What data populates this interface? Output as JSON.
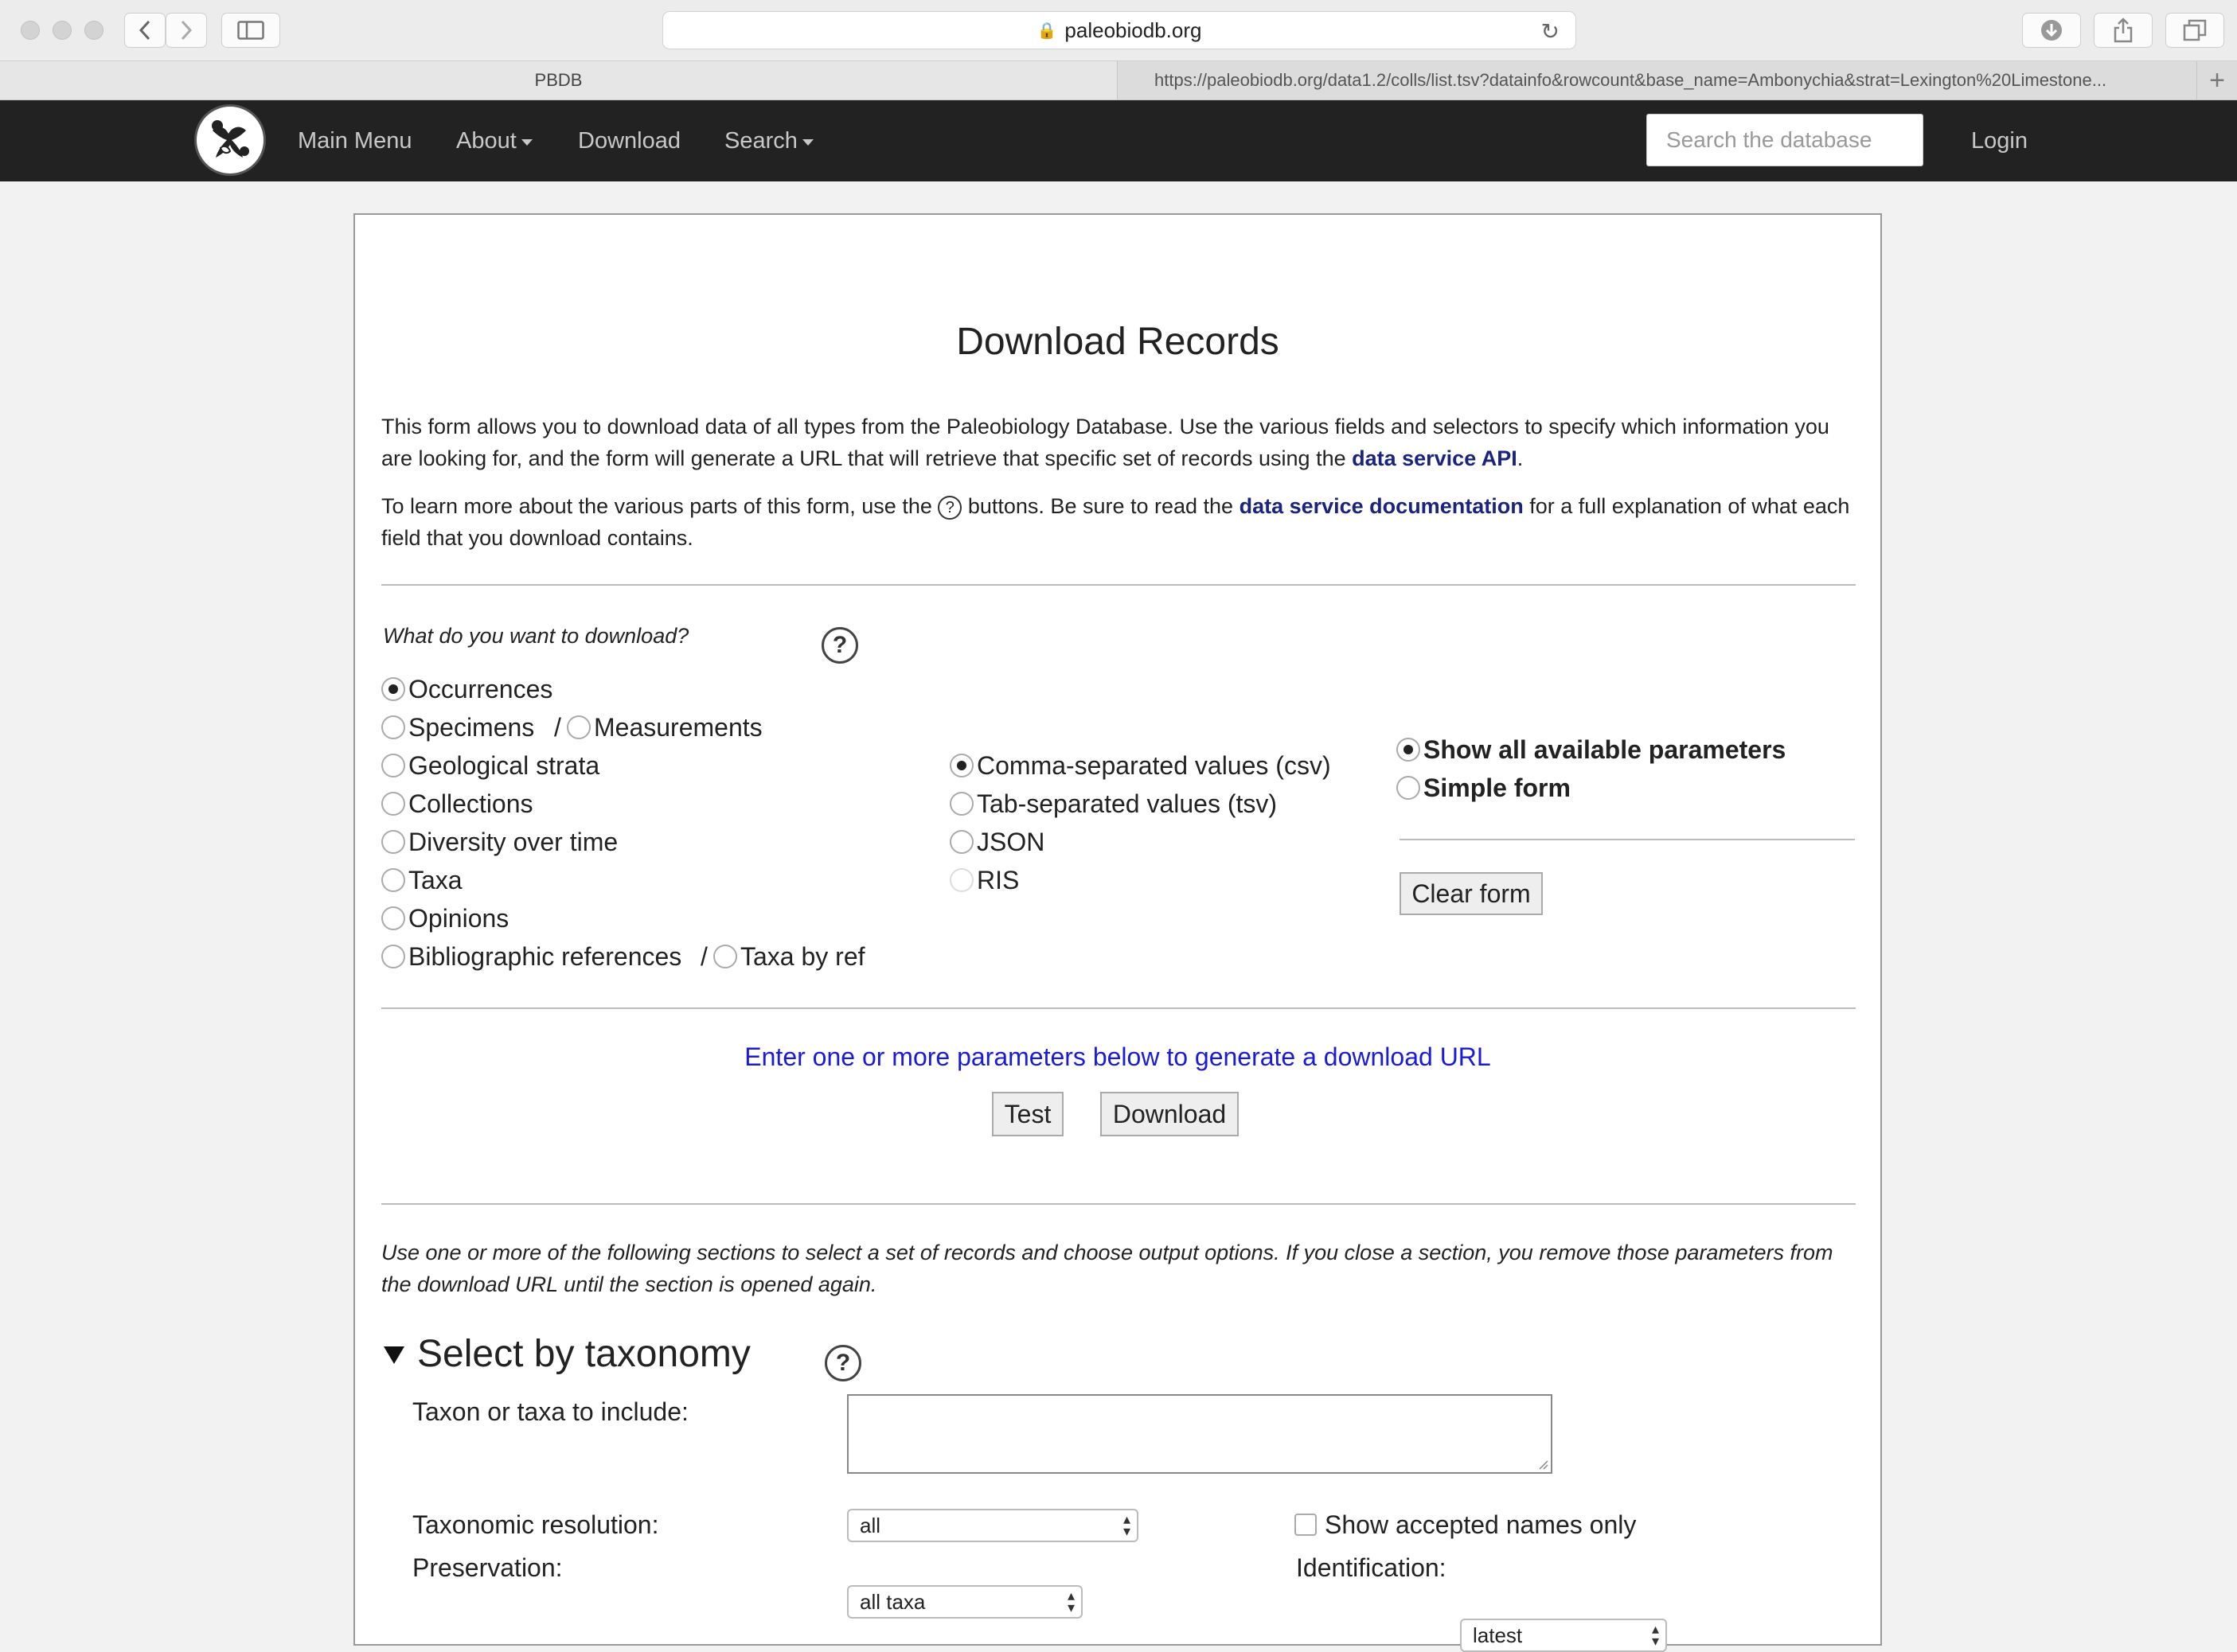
{
  "browser": {
    "url_host": "paleobiodb.org",
    "tabs": [
      {
        "label": "PBDB"
      },
      {
        "label": "https://paleobiodb.org/data1.2/colls/list.tsv?datainfo&rowcount&base_name=Ambonychia&strat=Lexington%20Limestone..."
      }
    ],
    "new_tab_symbol": "+"
  },
  "nav": {
    "items": [
      "Main Menu",
      "About",
      "Download",
      "Search"
    ],
    "search_placeholder": "Search the database",
    "login_label": "Login"
  },
  "page": {
    "title": "Download Records",
    "intro1_a": "This form allows you to download data of all types from the Paleobiology Database. Use the various fields and selectors to specify which information you are looking for, and the form will generate a URL that will retrieve that specific set of records using the ",
    "intro1_link": "data service API",
    "intro1_b": ".",
    "intro2_a": "To learn more about the various parts of this form, use the ",
    "intro2_help": "?",
    "intro2_b": " buttons. Be sure to read the ",
    "intro2_link": "data service documentation",
    "intro2_c": " for a full explanation of what each field that you download contains.",
    "question": "What do you want to download?",
    "help_symbol": "?",
    "types": {
      "occurrences": "Occurrences",
      "specimens": "Specimens",
      "slash": "/",
      "measurements": "Measurements",
      "strata": "Geological strata",
      "collections": "Collections",
      "diversity": "Diversity over time",
      "taxa": "Taxa",
      "opinions": "Opinions",
      "references": "Bibliographic references",
      "taxa_by_ref": "Taxa by ref"
    },
    "formats": [
      "Comma-separated values (csv)",
      "Tab-separated values (tsv)",
      "JSON",
      "RIS"
    ],
    "modes": [
      "Show all available parameters",
      "Simple form"
    ],
    "clear_label": "Clear form",
    "url_message": "Enter one or more parameters below to generate a download URL",
    "test_label": "Test",
    "download_label": "Download",
    "sections_intro": "Use one or more of the following sections to select a set of records and choose output options. If you close a section, you remove those parameters from the download URL until the section is opened again.",
    "taxonomy": {
      "heading": "Select by taxonomy",
      "taxa_label": "Taxon or taxa to include:",
      "resolution_label": "Taxonomic resolution:",
      "resolution_value": "all",
      "accepted_label": "Show accepted names only",
      "preservation_label": "Preservation:",
      "preservation_value": "all taxa",
      "identification_label": "Identification:",
      "identification_value": "latest"
    }
  }
}
